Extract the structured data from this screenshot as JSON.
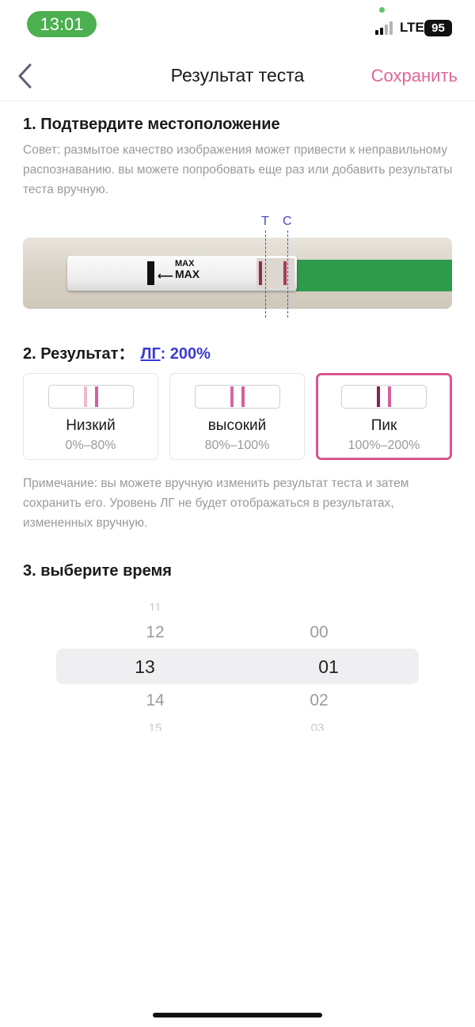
{
  "status": {
    "time": "13:01",
    "network": "LTE",
    "battery": "95"
  },
  "nav": {
    "title": "Результат теста",
    "save": "Сохранить",
    "back_icon": "chevron-left-icon"
  },
  "section1": {
    "heading": "1. Подтвердите местоположение",
    "hint": "Совет: размытое качество изображения может привести к неправильному распознаванию. вы можете попробовать еще раз или добавить результаты теста вручную.",
    "markers": {
      "test": "T",
      "control": "C"
    },
    "strip_text": {
      "arrow": "⟵",
      "label": "MAX"
    }
  },
  "section2": {
    "label": "2. Результат：",
    "hormone": "ЛГ",
    "value": ": 200%",
    "options": [
      {
        "name": "Низкий",
        "range": "0%–80%",
        "selected": false
      },
      {
        "name": "высокий",
        "range": "80%–100%",
        "selected": false
      },
      {
        "name": "Пик",
        "range": "100%–200%",
        "selected": true
      }
    ],
    "note": "Примечание: вы можете вручную изменить результат теста и затем сохранить его. Уровень ЛГ не будет отображаться в результатах, измененных вручную."
  },
  "section3": {
    "heading": "3. выберите время",
    "hours": [
      "11",
      "12",
      "13",
      "14",
      "15"
    ],
    "minutes": [
      "00",
      "01",
      "02",
      "03"
    ],
    "selected_hour": "13",
    "selected_minute": "01"
  },
  "colors": {
    "accent": "#e0669a",
    "link": "#3c3ccf",
    "selected_border": "#d9558f",
    "status_green": "#4caf50"
  }
}
